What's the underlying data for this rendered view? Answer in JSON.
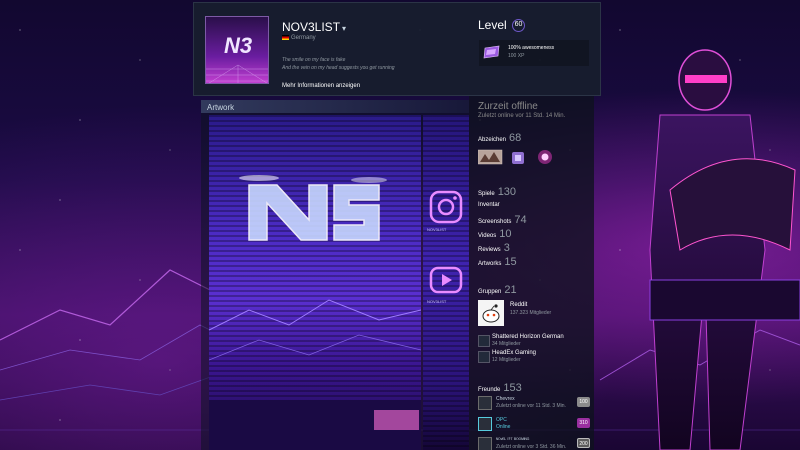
{
  "profile": {
    "persona_name": "NOV3LIST",
    "country": "Germany",
    "summary_lines": [
      "The smile on my face is fake",
      "And the vein on my head suggests you get running"
    ],
    "more_info": "Mehr Informationen anzeigen",
    "level_label": "Level",
    "level_value": "60",
    "favorite_badge": {
      "name": "100% awesomeness",
      "xp": "100 XP"
    }
  },
  "showcase": {
    "title": "Artwork",
    "side_captions": [
      "NOV3LIST",
      "NOV3LIST"
    ]
  },
  "sidebar": {
    "status": "Zurzeit offline",
    "last_online": "Zuletzt online vor 11 Std. 14 Min.",
    "badges": {
      "label": "Abzeichen",
      "count": "68"
    },
    "stats": [
      {
        "label": "Spiele",
        "count": "130"
      },
      {
        "label": "Inventar",
        "count": ""
      },
      {
        "label": "Screenshots",
        "count": "74"
      },
      {
        "label": "Videos",
        "count": "10"
      },
      {
        "label": "Reviews",
        "count": "3"
      },
      {
        "label": "Artworks",
        "count": "15"
      }
    ],
    "groups": {
      "label": "Gruppen",
      "count": "21",
      "items": [
        {
          "name": "Reddit",
          "members": "137.323 Mitglieder"
        },
        {
          "name": "Shattered Horizon German",
          "members": "34 Mitglieder"
        },
        {
          "name": "HeadEx Gaming",
          "members": "12 Mitglieder"
        }
      ]
    },
    "friends": {
      "label": "Freunde",
      "count": "153",
      "items": [
        {
          "name": "Chevrex",
          "status": "Zuletzt online vor 11 Std. 3 Min.",
          "level": "100",
          "online": false,
          "level_color": "#8b8b8b"
        },
        {
          "name": "OPC",
          "status": "Online",
          "level": "310",
          "online": true,
          "level_color": "#9a2fa0"
        },
        {
          "name": "ᴺᴼᵛᴱᴸ ᴵᔆᵀ ᴮᴼᴼᴹᴵᴺᴳ",
          "status": "Zuletzt online vor 3 Std. 36 Min.",
          "level": "200",
          "online": false,
          "level_color": "#5c5c5c"
        }
      ]
    }
  },
  "colors": {
    "accent": "#6e58c9",
    "online": "#57cbde",
    "panel": "#181e2e"
  }
}
